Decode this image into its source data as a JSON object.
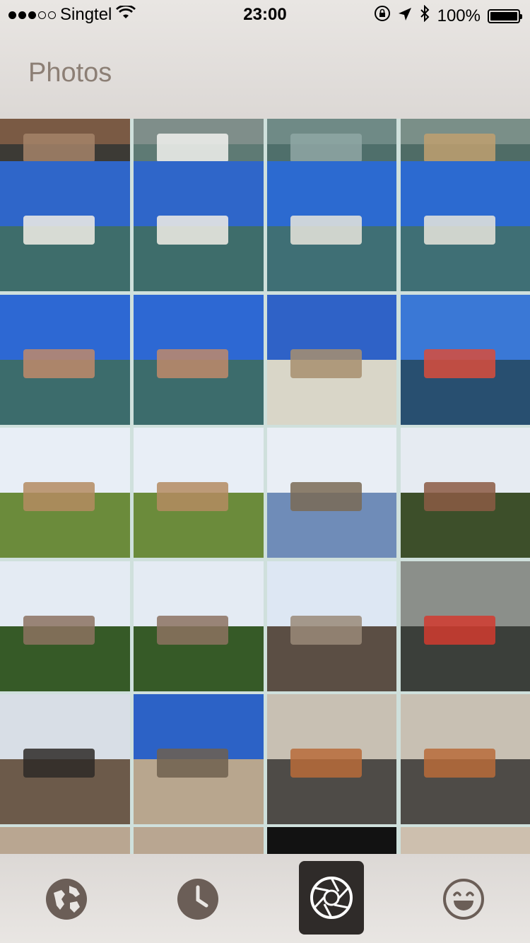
{
  "status_bar": {
    "carrier": "Singtel",
    "signal_strength": 3,
    "signal_max": 5,
    "time": "23:00",
    "battery_text": "100%",
    "battery_level": 1.0
  },
  "header": {
    "title": "Photos"
  },
  "grid": {
    "rows": [
      [
        "venice-canal-building",
        "venice-boat-wake",
        "venice-lagoon",
        "venice-lagoon-boat"
      ],
      [
        "venice-water-taxi",
        "venice-water-taxi",
        "venice-salute-boat",
        "venice-salute-boat"
      ],
      [
        "venice-san-giorgio",
        "venice-san-giorgio",
        "venice-palazzo",
        "venice-grand-canal"
      ],
      [
        "rome-forum",
        "rome-forum",
        "rome-column-sky",
        "rome-ruins-trees"
      ],
      [
        "rome-capital-gull",
        "rome-capital-gull",
        "rome-capital-closeup",
        "rome-street-artist"
      ],
      [
        "rome-street-view",
        "rome-baroque-facade",
        "rome-church-steps-crowd",
        "rome-church-steps-crowd"
      ],
      [
        "rome-building-partial",
        "rome-building-partial",
        "dark-photo",
        "rome-crowd-partial"
      ]
    ],
    "palettes": {
      "venice-canal-building": [
        "#7a5a44",
        "#3c3a35",
        "#a58468"
      ],
      "venice-boat-wake": [
        "#7f8e8a",
        "#5e7a74",
        "#f2f2ee"
      ],
      "venice-lagoon": [
        "#6f8a86",
        "#4f6f6b",
        "#8fa7a4"
      ],
      "venice-lagoon-boat": [
        "#7a8f88",
        "#4f6c66",
        "#c0a070"
      ],
      "venice-water-taxi": [
        "#2f66c9",
        "#3e6d6b",
        "#f2efe6"
      ],
      "venice-salute-boat": [
        "#2c6ad0",
        "#3f6f75",
        "#e9e6dd"
      ],
      "venice-san-giorgio": [
        "#2d68d3",
        "#3c6c6c",
        "#c08a6a"
      ],
      "venice-palazzo": [
        "#2f62c7",
        "#d9d6c8",
        "#a78f6f"
      ],
      "venice-grand-canal": [
        "#3a78d6",
        "#284f70",
        "#d94c3b"
      ],
      "rome-forum": [
        "#e8eef6",
        "#6b8b3b",
        "#b48b62"
      ],
      "rome-column-sky": [
        "#e9eef5",
        "#6f8cb8",
        "#7a6a55"
      ],
      "rome-ruins-trees": [
        "#e6ebf2",
        "#3d4f2a",
        "#8b5b44"
      ],
      "rome-capital-gull": [
        "#e4ebf3",
        "#365a27",
        "#8c7260"
      ],
      "rome-capital-closeup": [
        "#dde7f3",
        "#5b4e44",
        "#9a8a78"
      ],
      "rome-street-artist": [
        "#8b8f8a",
        "#3b3f3a",
        "#d23b2f"
      ],
      "rome-street-view": [
        "#d8dee6",
        "#6c5a4a",
        "#2e2a27"
      ],
      "rome-baroque-facade": [
        "#2c62c6",
        "#b8a68e",
        "#6f604f"
      ],
      "rome-church-steps-crowd": [
        "#c8c0b3",
        "#4e4b47",
        "#b86b3a"
      ],
      "rome-building-partial": [
        "#b9a691",
        "#4b4640",
        "#e7dbc8"
      ],
      "dark-photo": [
        "#121212",
        "#1f1f1f",
        "#2a2a2a"
      ],
      "rome-crowd-partial": [
        "#cdbfae",
        "#4b4a46",
        "#b66c3a"
      ]
    }
  },
  "tabbar": {
    "tabs": [
      {
        "name": "explore",
        "icon": "globe-icon",
        "active": false
      },
      {
        "name": "recent",
        "icon": "clock-icon",
        "active": false
      },
      {
        "name": "photos",
        "icon": "shutter-icon",
        "active": true
      },
      {
        "name": "moments",
        "icon": "smiley-icon",
        "active": false
      }
    ],
    "icon_color": "#6b5e57",
    "active_bg": "#2f2b29",
    "active_icon_color": "#ffffff"
  }
}
